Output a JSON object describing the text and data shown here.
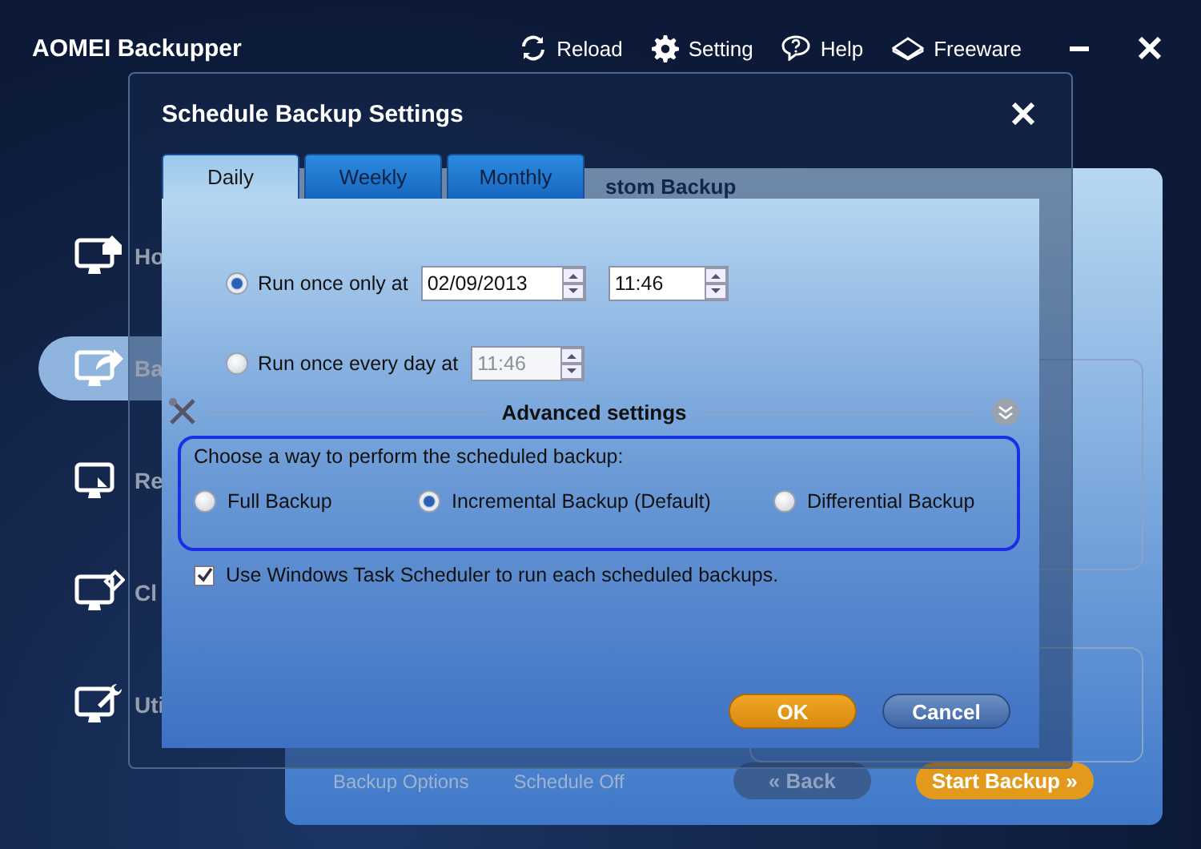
{
  "app": {
    "title": "AOMEI Backupper",
    "toolbar": [
      {
        "label": "Reload",
        "kind": "reload"
      },
      {
        "label": "Setting",
        "kind": "setting"
      },
      {
        "label": "Help",
        "kind": "help"
      },
      {
        "label": "Freeware",
        "kind": "freeware"
      }
    ],
    "sidebar": {
      "items": [
        {
          "label": "Ho",
          "kind": "home",
          "selected": false
        },
        {
          "label": "Ba",
          "kind": "backup",
          "selected": true
        },
        {
          "label": "Re",
          "kind": "restore",
          "selected": false
        },
        {
          "label": "Cl",
          "kind": "clone",
          "selected": false
        },
        {
          "label": "Uti",
          "kind": "utilities",
          "selected": false
        }
      ]
    },
    "content": {
      "heading": "stom Backup",
      "options": "Backup Options",
      "schedule": "Schedule Off",
      "back": "« Back",
      "start": "Start Backup »"
    }
  },
  "dialog": {
    "title": "Schedule Backup Settings",
    "tabs": [
      {
        "label": "Daily",
        "selected": true
      },
      {
        "label": "Weekly",
        "selected": false
      },
      {
        "label": "Monthly",
        "selected": false
      }
    ],
    "schedule_options": [
      {
        "label": "Run once only at",
        "selected": true,
        "fields": [
          {
            "value": "02/09/2013",
            "disabled": false
          },
          {
            "value": "11:46",
            "disabled": false
          }
        ]
      },
      {
        "label": "Run once every day at",
        "selected": false,
        "fields": [
          {
            "value": "11:46",
            "disabled": true
          }
        ]
      }
    ],
    "advanced_title": "Advanced settings",
    "method_prompt": "Choose a way to perform the scheduled backup:",
    "methods": [
      {
        "label": "Full Backup",
        "selected": false
      },
      {
        "label": "Incremental Backup (Default)",
        "selected": true
      },
      {
        "label": "Differential Backup",
        "selected": false
      }
    ],
    "task_scheduler": {
      "label": "Use Windows Task Scheduler to run each scheduled backups.",
      "checked": true
    },
    "buttons": [
      {
        "label": "OK",
        "kind": "primary"
      },
      {
        "label": "Cancel",
        "kind": "secondary"
      }
    ]
  }
}
